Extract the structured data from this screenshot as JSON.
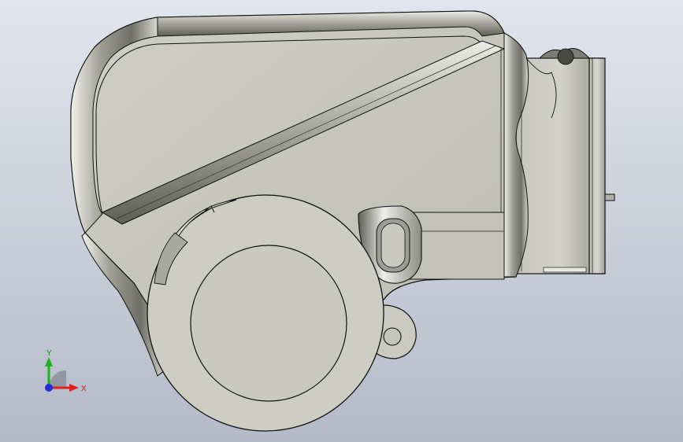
{
  "viewport": {
    "view": "front",
    "background_top": "#e2e5ee",
    "background_bottom": "#b4bac8"
  },
  "model": {
    "part": "housing",
    "body_color": "#c8c8bd",
    "edge_color": "#111111",
    "highlight_color": "#f4f4ee",
    "shadow_color": "#6e6e66"
  },
  "triad": {
    "x_label": "X",
    "y_label": "Y",
    "x_color": "#e02020",
    "y_color": "#20b020",
    "z_color": "#2030d0"
  }
}
